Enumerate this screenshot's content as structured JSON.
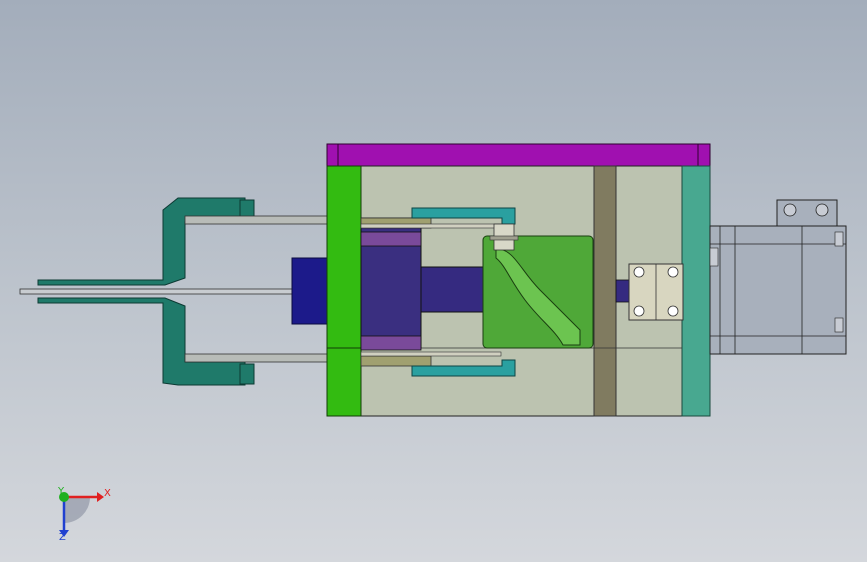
{
  "triad": {
    "x_label": "X",
    "y_label": "Y",
    "z_label": "Z",
    "x_color": "#e02020",
    "y_color": "#20b020",
    "z_color": "#2040d0"
  },
  "colors": {
    "top_plate": "#a010b0",
    "left_plate": "#33bb11",
    "right_plate": "#48a890",
    "housing": "#bcc3b0",
    "nozzle_bracket": "#1f7a6a",
    "purple_block": "#3a2f80",
    "green_screw": "#4fa838",
    "motor": "#a8b0bc"
  }
}
